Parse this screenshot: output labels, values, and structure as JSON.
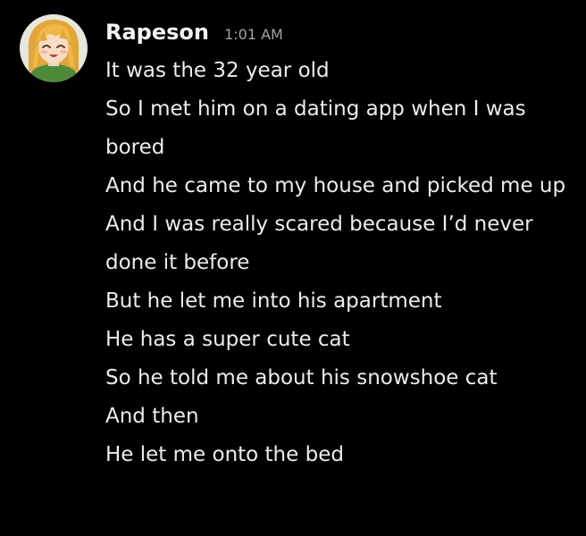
{
  "message_group": {
    "author": {
      "username": "Rapeson",
      "timestamp": "1:01 AM",
      "avatar_icon": "anime-girl-avatar"
    },
    "messages": [
      "It was the 32 year old",
      "So I met him on a dating app when I was bored",
      "And he came to my house and picked me up",
      "And I was really scared because I’d never done it before",
      "But he let me into his apartment",
      "He has a super cute cat",
      "So he told me about his snowshoe cat",
      "And then",
      "He let me onto the bed"
    ]
  },
  "colors": {
    "background": "#000000",
    "username": "#f2f3f5",
    "timestamp": "#a0a3a8",
    "message_text": "#ececec"
  }
}
